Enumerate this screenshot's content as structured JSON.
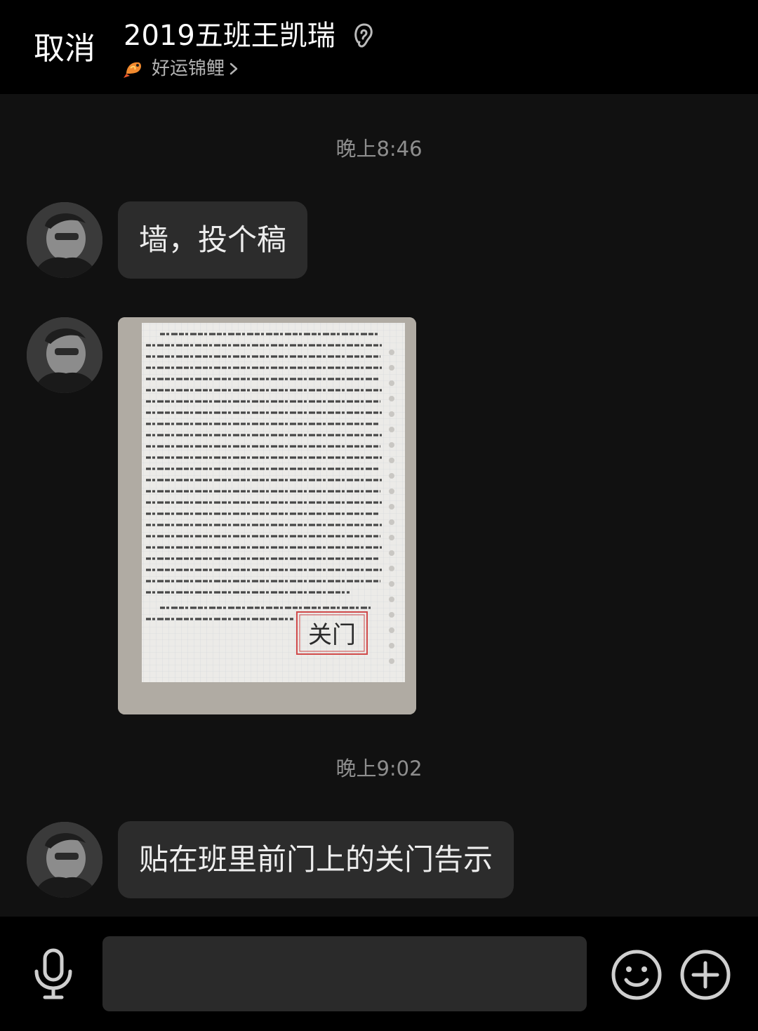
{
  "header": {
    "cancel_label": "取消",
    "title": "2019五班王凯瑞",
    "subtitle": "好运锦鲤",
    "icons": [
      "ear-icon",
      "koi-fish-icon",
      "chevron-right-icon"
    ]
  },
  "messages": [
    {
      "type": "timestamp",
      "text": "晚上8:46"
    },
    {
      "type": "text",
      "text": "墙，投个稿"
    },
    {
      "type": "image",
      "note_stamp": "关门"
    },
    {
      "type": "timestamp",
      "text": "晚上9:02"
    },
    {
      "type": "text",
      "text": "贴在班里前门上的关门告示"
    }
  ],
  "input_bar": {
    "placeholder": "",
    "icons": [
      "microphone-icon",
      "emoji-icon",
      "plus-icon"
    ]
  },
  "colors": {
    "background": "#111111",
    "header_bg": "#000000",
    "bubble_bg": "#2c2c2c",
    "timestamp": "#8e8e8e"
  }
}
